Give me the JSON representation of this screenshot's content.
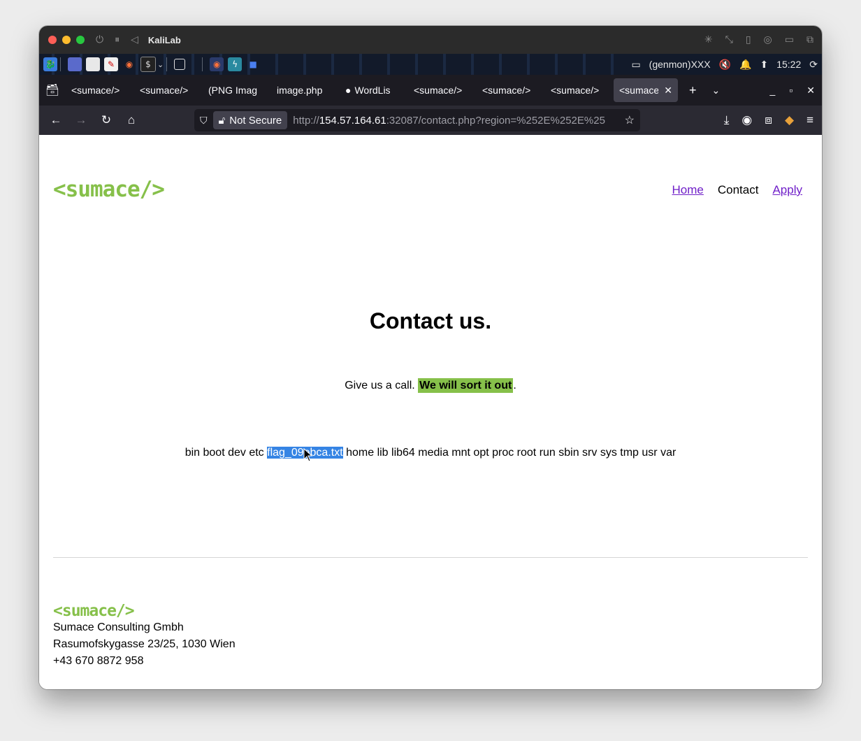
{
  "vm": {
    "title": "KaliLab"
  },
  "panel": {
    "status_text": "(genmon)XXX",
    "clock": "15:22"
  },
  "tabs": [
    {
      "label": "<sumace/>"
    },
    {
      "label": "<sumace/>"
    },
    {
      "label": "(PNG Imag"
    },
    {
      "label": "image.php"
    },
    {
      "label": "WordLis"
    },
    {
      "label": "<sumace/>"
    },
    {
      "label": "<sumace/>"
    },
    {
      "label": "<sumace/>"
    },
    {
      "label": "<sumace/"
    }
  ],
  "navbar": {
    "security_label": "Not Secure",
    "url_prefix": "http://",
    "url_host": "154.57.164.61",
    "url_rest": ":32087/contact.php?region=%252E%252E%25"
  },
  "site": {
    "logo": "<sumace/>",
    "nav": {
      "home": "Home",
      "contact": "Contact",
      "apply": "Apply"
    },
    "heading": "Contact us.",
    "tagline_pre": "Give us a call. ",
    "tagline_highlight": "We will sort it out",
    "tagline_post": ".",
    "listing_pre": "bin boot dev etc ",
    "listing_selected": "flag_09ebca.txt",
    "listing_post": " home lib lib64 media mnt opt proc root run sbin srv sys tmp usr var",
    "footer": {
      "logo": "<sumace/>",
      "company": "Sumace Consulting Gmbh",
      "address": "Rasumofskygasse 23/25, 1030 Wien",
      "phone": "+43 670 8872 958"
    }
  },
  "colors": {
    "brand_green": "#86c04a",
    "link_purple": "#6f1ec8",
    "selection_blue": "#3584e4"
  }
}
